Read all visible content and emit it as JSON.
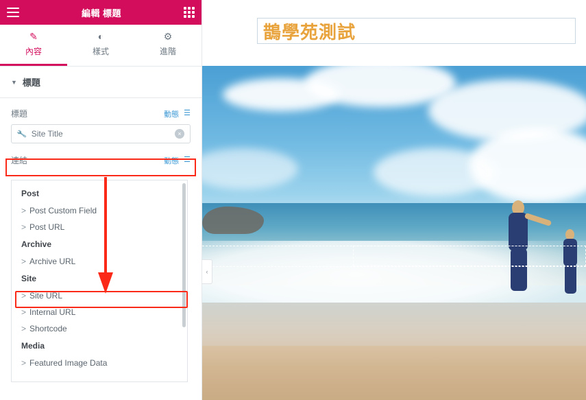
{
  "panel": {
    "header": {
      "title": "編輯 標題",
      "menu_icon": "hamburger-icon",
      "apps_icon": "grid-apps-icon"
    },
    "tabs": [
      {
        "label": "內容",
        "icon": "pencil-icon",
        "active": true
      },
      {
        "label": "樣式",
        "icon": "contrast-icon",
        "active": false
      },
      {
        "label": "進階",
        "icon": "gear-icon",
        "active": false
      }
    ],
    "section": {
      "title": "標題",
      "caret": "▼"
    },
    "title_field": {
      "label": "標題",
      "dynamic_label": "動態",
      "dynamic_icon": "database-icon",
      "value": "Site Title",
      "prefix_icon": "wrench-icon",
      "clear_icon": "×"
    },
    "link_field": {
      "label": "連結",
      "dynamic_label": "動態",
      "dynamic_icon": "database-icon"
    },
    "dropdown": {
      "groups": [
        {
          "name": "Post",
          "items": [
            "Post Custom Field",
            "Post URL"
          ]
        },
        {
          "name": "Archive",
          "items": [
            "Archive URL"
          ]
        },
        {
          "name": "Site",
          "items": [
            "Site URL",
            "Internal URL",
            "Shortcode"
          ]
        },
        {
          "name": "Media",
          "items": [
            "Featured Image Data"
          ]
        }
      ],
      "item_prefix": ">",
      "highlighted_item": "Site URL"
    },
    "annotation": {
      "arrow_color": "#fb2a18",
      "highlight_color": "#fb2a18"
    }
  },
  "preview": {
    "site_title": "鵲學苑測試",
    "title_color": "#e8a33d",
    "collapse_icon": "‹"
  }
}
